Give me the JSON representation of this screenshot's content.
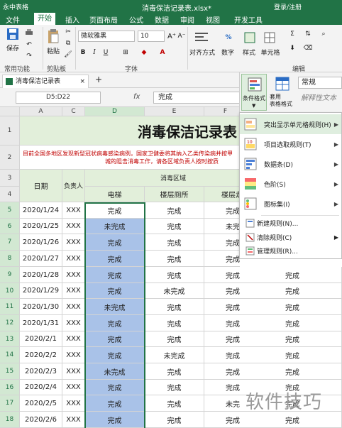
{
  "app": {
    "name": "永中表格",
    "document": "消毒保洁记录表.xlsx*",
    "user": "登录/注册"
  },
  "menu_tabs": [
    "文件",
    "开始",
    "插入",
    "页面布局",
    "公式",
    "数据",
    "审阅",
    "视图",
    "开发工具"
  ],
  "active_tab": "开始",
  "ribbon": {
    "save": "保存",
    "paste": "粘贴",
    "font_name": "微软雅黑",
    "font_size": "10",
    "align": "对齐方式",
    "number": "数字",
    "style": "样式",
    "cell": "单元格",
    "groups": {
      "common": "常用功能",
      "clipboard": "剪贴板",
      "font": "字体",
      "edit": "编辑"
    }
  },
  "doc_tab": "消毒保洁记录表",
  "namebox": "D5:D22",
  "fx": "fx",
  "formula_value": "完成",
  "context_panel": {
    "conditional_format": "条件格式",
    "table_format": "套用\n表格格式",
    "number_format": "常规",
    "placeholder": "解释性文本"
  },
  "dropdown": {
    "items": [
      "突出显示单元格规则(H)",
      "项目选取规则(T)",
      "数据条(D)",
      "色阶(S)",
      "图标集(I)"
    ],
    "small_items": [
      "新建规则(N)...",
      "清除规则(C)",
      "管理规则(R)..."
    ]
  },
  "sheet": {
    "columns": [
      "A",
      "B",
      "C",
      "D",
      "E",
      "F"
    ],
    "title": "消毒保洁记录表",
    "notice": [
      "目前全国多地区发现新型冠状病毒感染病例，国家卫健委将其纳入乙类传染病并按甲",
      "城的阻击消毒工作，请各区域负责人按时按质"
    ],
    "h_date": "日期",
    "h_person": "负责人",
    "h_area": "消毒区域",
    "h_elevator": "电梯",
    "h_stair": "楼层厕所",
    "h_stair2": "楼层走",
    "rows": [
      {
        "n": "5",
        "date": "2020/1/24",
        "p": "XXX",
        "d": "完成",
        "e": "完成",
        "f": "完成"
      },
      {
        "n": "6",
        "date": "2020/1/25",
        "p": "XXX",
        "d": "未完成",
        "e": "完成",
        "f": "未完"
      },
      {
        "n": "7",
        "date": "2020/1/26",
        "p": "XXX",
        "d": "完成",
        "e": "完成",
        "f": "完成"
      },
      {
        "n": "8",
        "date": "2020/1/27",
        "p": "XXX",
        "d": "完成",
        "e": "完成",
        "f": "完成"
      },
      {
        "n": "9",
        "date": "2020/1/28",
        "p": "XXX",
        "d": "完成",
        "e": "完成",
        "f": "完成"
      },
      {
        "n": "10",
        "date": "2020/1/29",
        "p": "XXX",
        "d": "完成",
        "e": "未完成",
        "f": "完成"
      },
      {
        "n": "11",
        "date": "2020/1/30",
        "p": "XXX",
        "d": "未完成",
        "e": "完成",
        "f": "完成"
      },
      {
        "n": "12",
        "date": "2020/1/31",
        "p": "XXX",
        "d": "完成",
        "e": "完成",
        "f": "完成"
      },
      {
        "n": "13",
        "date": "2020/2/1",
        "p": "XXX",
        "d": "完成",
        "e": "完成",
        "f": "完成"
      },
      {
        "n": "14",
        "date": "2020/2/2",
        "p": "XXX",
        "d": "完成",
        "e": "未完成",
        "f": "完成"
      },
      {
        "n": "15",
        "date": "2020/2/3",
        "p": "XXX",
        "d": "未完成",
        "e": "完成",
        "f": "完成"
      },
      {
        "n": "16",
        "date": "2020/2/4",
        "p": "XXX",
        "d": "完成",
        "e": "完成",
        "f": "完成"
      },
      {
        "n": "17",
        "date": "2020/2/5",
        "p": "XXX",
        "d": "完成",
        "e": "完成",
        "f": "未完"
      },
      {
        "n": "18",
        "date": "2020/2/6",
        "p": "XXX",
        "d": "完成",
        "e": "完成",
        "f": "完成"
      }
    ],
    "right_values": [
      "完成",
      "完成",
      "完成",
      "完成",
      "完成",
      "完成",
      "完成",
      "完成",
      "完成",
      "完成",
      "完成"
    ]
  },
  "watermark": "软件技巧",
  "colors": {
    "accent": "#217346",
    "title_red": "#c00000",
    "selection": "#a9c2e8",
    "header_fill": "#e2efda"
  }
}
